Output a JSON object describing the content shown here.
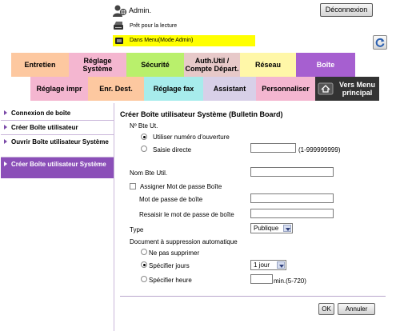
{
  "header": {
    "user": "Admin.",
    "logout": "Déconnexion",
    "status": "Prêt pour la lecture",
    "mode": "Dans Menu(Mode Admin)"
  },
  "tabs_row1": [
    {
      "label": "Entretien",
      "color": "#fdc8a0"
    },
    {
      "label": "Réglage Système",
      "color": "#f4b6d0"
    },
    {
      "label": "Sécurité",
      "color": "#b9f06c"
    },
    {
      "label": "Auth.Util / Compte Départ.",
      "color": "#e7c9c9"
    },
    {
      "label": "Réseau",
      "color": "#fff7a8"
    },
    {
      "label": "Boîte",
      "color": "#a65fd0"
    }
  ],
  "tabs_row2": [
    {
      "label": "Réglage impr",
      "color": "#f4b6d0"
    },
    {
      "label": "Enr. Dest.",
      "color": "#fdc8a0"
    },
    {
      "label": "Réglage fax",
      "color": "#a7ecec"
    },
    {
      "label": "Assistant",
      "color": "#d8d0e8"
    },
    {
      "label": "Personnaliser",
      "color": "#f4b6d0"
    },
    {
      "label": "Vers Menu principal",
      "color": "#333333"
    }
  ],
  "sidebar": {
    "items": [
      {
        "label": "Connexion de boîte"
      },
      {
        "label": "Créer Boîte utilisateur"
      },
      {
        "label": "Ouvrir Boîte utilisateur Système"
      },
      {
        "label": "Créer Boîte utilisateur Système"
      }
    ]
  },
  "form": {
    "title": "Créer Boîte utilisateur Système (Bulletin Board)",
    "box_no_label": "Nº Bte Ut.",
    "opt_open_number": "Utiliser numéro d'ouverture",
    "opt_direct": "Saisie directe",
    "direct_value": "",
    "direct_range": "(1-999999999)",
    "name_label": "Nom Bte Util.",
    "name_value": "",
    "assign_password": "Assigner Mot de passe Boîte",
    "password_label": "Mot de passe de boîte",
    "password_value": "",
    "retype_label": "Resaisir le mot de passe de boîte",
    "retype_value": "",
    "type_label": "Type",
    "type_value": "Publique",
    "autodelete_label": "Document à suppression automatique",
    "opt_no_delete": "Ne pas supprimer",
    "opt_days": "Spécifier jours",
    "days_value": "1 jour",
    "opt_hours": "Spécifier heure",
    "hours_value": "",
    "hours_range": "min.(5-720)",
    "ok": "OK",
    "cancel": "Annuler"
  }
}
